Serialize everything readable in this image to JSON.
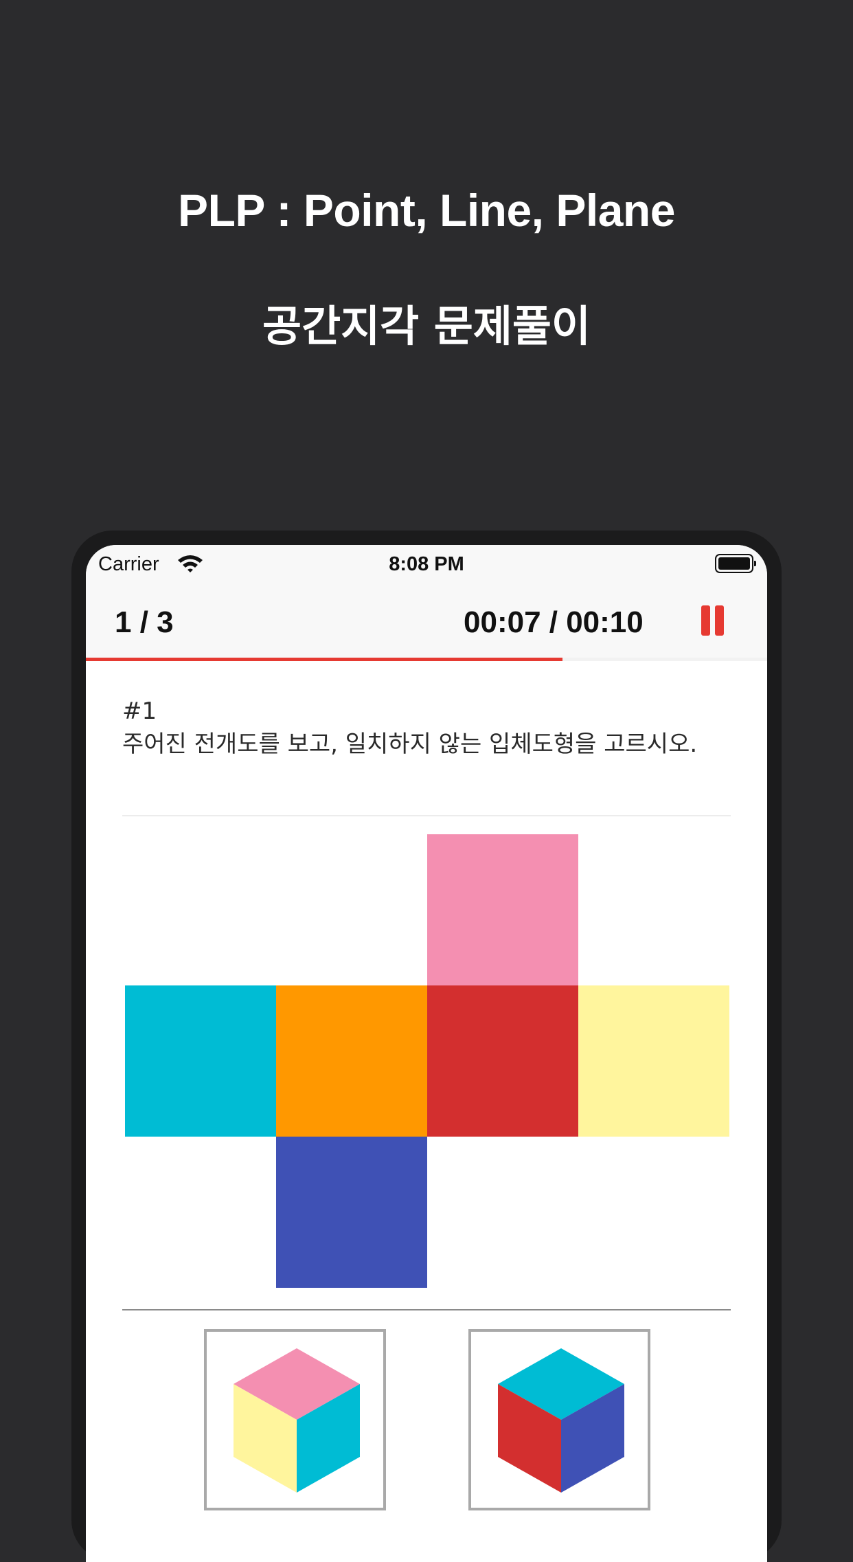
{
  "promo": {
    "title": "PLP : Point, Line, Plane",
    "subtitle": "공간지각 문제풀이"
  },
  "status_bar": {
    "carrier": "Carrier",
    "time": "8:08 PM",
    "icons": [
      "wifi-icon",
      "battery-icon"
    ]
  },
  "nav": {
    "counter": "1 / 3",
    "timer": "00:07 / 00:10",
    "pause_icon": "pause-icon",
    "accent_color": "#e63a32"
  },
  "progress": {
    "fraction": 0.7
  },
  "question": {
    "number": "#1",
    "prompt": "주어진 전개도를 보고, 일치하지 않는 입체도형을 고르시오."
  },
  "net": {
    "faces": [
      {
        "name": "top",
        "color": "#f48fb1"
      },
      {
        "name": "left",
        "color": "#00bcd4"
      },
      {
        "name": "center-left",
        "color": "#ff9800"
      },
      {
        "name": "center",
        "color": "#d32f2f"
      },
      {
        "name": "right",
        "color": "#fff59d"
      },
      {
        "name": "bottom",
        "color": "#3f51b5"
      }
    ]
  },
  "answers": [
    {
      "top": "#f48fb1",
      "left": "#fff59d",
      "right": "#00bcd4"
    },
    {
      "top": "#00bcd4",
      "left": "#d32f2f",
      "right": "#3f51b5"
    }
  ]
}
